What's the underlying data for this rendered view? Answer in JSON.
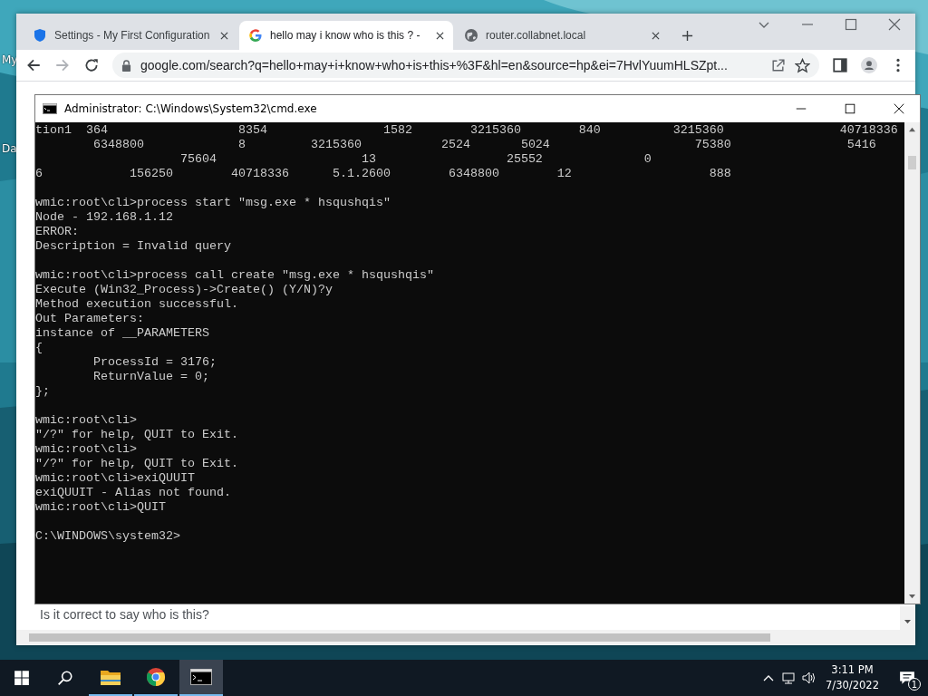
{
  "desktop": {
    "icon_labels": [
      "My",
      "Da"
    ]
  },
  "browser": {
    "tabs": [
      {
        "kind": "shield",
        "title": "Settings - My First Configuration",
        "selected": false
      },
      {
        "kind": "google",
        "title": "hello may i know who is this ? -",
        "selected": true
      },
      {
        "kind": "globe",
        "title": "router.collabnet.local",
        "selected": false
      }
    ],
    "address": "google.com/search?q=hello+may+i+know+who+is+this+%3F&hl=en&source=hp&ei=7HvlYuumHLSZpt...",
    "page_text": "Is it correct to say who is this?"
  },
  "console": {
    "title": "Administrator: C:\\Windows\\System32\\cmd.exe",
    "blocks": [
      [
        "tion1  364                  8354                1582        3215360        840          3215360                40718336",
        "        6348800             8         3215360           2524       5024                    75380                5416",
        "                    75604                    13                  25552              0",
        "6            156250        40718336      5.1.2600        6348800        12                   888"
      ],
      [
        "wmic:root\\cli>process start \"msg.exe * hsqushqis\"",
        "Node - 192.168.1.12",
        "ERROR:",
        "Description = Invalid query"
      ],
      [
        "wmic:root\\cli>process call create \"msg.exe * hsqushqis\"",
        "Execute (Win32_Process)->Create() (Y/N)?y",
        "Method execution successful.",
        "Out Parameters:",
        "instance of __PARAMETERS",
        "{",
        "        ProcessId = 3176;",
        "        ReturnValue = 0;",
        "};"
      ],
      [
        "wmic:root\\cli>",
        "\"/?\" for help, QUIT to Exit.",
        "wmic:root\\cli>",
        "\"/?\" for help, QUIT to Exit.",
        "wmic:root\\cli>exiQUUIT",
        "exiQUUIT - Alias not found.",
        "wmic:root\\cli>QUIT"
      ],
      [
        "C:\\WINDOWS\\system32>"
      ]
    ]
  },
  "taskbar": {
    "apps": [
      {
        "kind": "explorer",
        "active": false
      },
      {
        "kind": "chrome",
        "active": false
      },
      {
        "kind": "cmd",
        "active": true
      }
    ],
    "time": "3:11 PM",
    "date": "7/30/2022",
    "notification_count": "1"
  }
}
